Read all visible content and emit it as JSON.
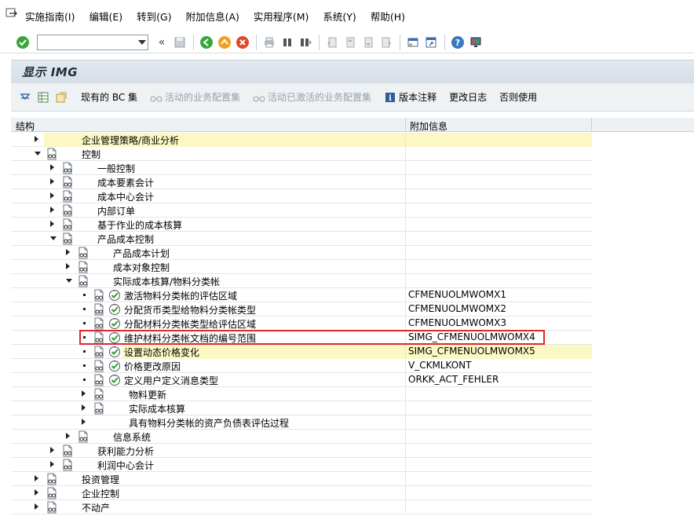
{
  "menu": {
    "items": [
      "实施指南(I)",
      "编辑(E)",
      "转到(G)",
      "附加信息(A)",
      "实用程序(M)",
      "系统(Y)",
      "帮助(H)"
    ]
  },
  "toolbar": {
    "command_value": "",
    "icons": [
      "check-icon",
      "back-icon",
      "save-icon",
      "nav-back-icon",
      "nav-exit-icon",
      "cancel-icon",
      "print-icon",
      "find-icon",
      "find-next-icon",
      "first-page-icon",
      "prev-page-icon",
      "next-page-icon",
      "last-page-icon",
      "new-session-icon",
      "shortcut-icon",
      "help-icon",
      "layout-icon"
    ]
  },
  "title": "显示 IMG",
  "app_toolbar": {
    "bc_sets": "现有的 BC 集",
    "active_bc": "活动的业务配置集",
    "activated_bc": "活动已激活的业务配置集",
    "release_notes": "版本注释",
    "change_log": "更改日志",
    "obsolete": "否则使用"
  },
  "columns": {
    "structure": "结构",
    "info": "附加信息"
  },
  "colors": {
    "highlight": "#fbf8c4",
    "redbox": "#e0262a",
    "title_band": "#dce3ea"
  },
  "rows": [
    {
      "label": "企业管理策略/商业分析",
      "info": ""
    },
    {
      "label": "控制",
      "info": ""
    },
    {
      "label": "一般控制",
      "info": ""
    },
    {
      "label": "成本要素会计",
      "info": ""
    },
    {
      "label": "成本中心会计",
      "info": ""
    },
    {
      "label": "内部订单",
      "info": ""
    },
    {
      "label": "基于作业的成本核算",
      "info": ""
    },
    {
      "label": "产品成本控制",
      "info": ""
    },
    {
      "label": "产品成本计划",
      "info": ""
    },
    {
      "label": "成本对象控制",
      "info": ""
    },
    {
      "label": "实际成本核算/物料分类帐",
      "info": ""
    },
    {
      "label": "激活物料分类帐的评估区域",
      "info": "CFMENUOLMWOMX1"
    },
    {
      "label": "分配货币类型给物料分类帐类型",
      "info": "CFMENUOLMWOMX2"
    },
    {
      "label": "分配材料分类帐类型给评估区域",
      "info": "CFMENUOLMWOMX3"
    },
    {
      "label": "维护材料分类帐文档的编号范围",
      "info": "SIMG_CFMENUOLMWOMX4"
    },
    {
      "label": "设置动态价格变化",
      "info": "SIMG_CFMENUOLMWOMX5"
    },
    {
      "label": "价格更改原因",
      "info": "V_CKMLKONT"
    },
    {
      "label": "定义用户定义消息类型",
      "info": "ORKK_ACT_FEHLER"
    },
    {
      "label": "物料更新",
      "info": ""
    },
    {
      "label": "实际成本核算",
      "info": ""
    },
    {
      "label": "具有物料分类帐的资产负债表评估过程",
      "info": ""
    },
    {
      "label": "信息系统",
      "info": ""
    },
    {
      "label": "获利能力分析",
      "info": ""
    },
    {
      "label": "利润中心会计",
      "info": ""
    },
    {
      "label": "投资管理",
      "info": ""
    },
    {
      "label": "企业控制",
      "info": ""
    },
    {
      "label": "不动产",
      "info": ""
    }
  ]
}
